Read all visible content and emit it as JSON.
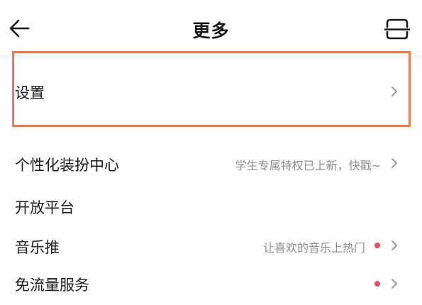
{
  "header": {
    "title": "更多",
    "back_icon": "arrow-left-icon",
    "scan_icon": "scan-icon"
  },
  "items": [
    {
      "label": "设置",
      "subtitle": "",
      "dot": false,
      "chevron": true
    },
    {
      "label": "个性化装扮中心",
      "subtitle": "学生专属特权已上新，快戳~",
      "dot": false,
      "chevron": true
    },
    {
      "label": "开放平台",
      "subtitle": "",
      "dot": false,
      "chevron": false
    },
    {
      "label": "音乐推",
      "subtitle": "让喜欢的音乐上热门",
      "dot": true,
      "chevron": true
    },
    {
      "label": "免流量服务",
      "subtitle": "",
      "dot": true,
      "chevron": true
    }
  ],
  "colors": {
    "highlight": "#ee7a52",
    "dot": "#f0495b",
    "subtitle": "#8c8c8c"
  }
}
